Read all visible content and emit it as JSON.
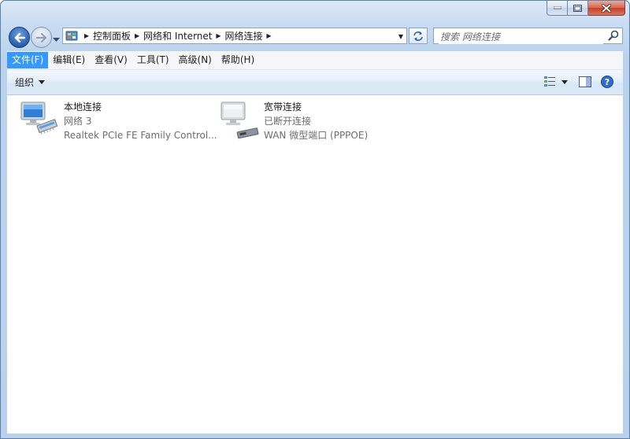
{
  "address": {
    "crumbs": [
      "控制面板",
      "网络和 Internet",
      "网络连接"
    ]
  },
  "search": {
    "placeholder": "搜索 网络连接"
  },
  "menu": {
    "items": [
      "文件(F)",
      "编辑(E)",
      "查看(V)",
      "工具(T)",
      "高级(N)",
      "帮助(H)"
    ],
    "active_index": 0
  },
  "toolbar": {
    "organize_label": "组织"
  },
  "connections": [
    {
      "name": "本地连接",
      "status": "网络  3",
      "device": "Realtek PCIe FE Family Control..."
    },
    {
      "name": "宽带连接",
      "status": "已断开连接",
      "device": "WAN 微型端口 (PPPOE)"
    }
  ],
  "colors": {
    "menu_active": "#3399ff",
    "secondary_text": "#6d6d6d",
    "close_button": "#c7402a"
  }
}
